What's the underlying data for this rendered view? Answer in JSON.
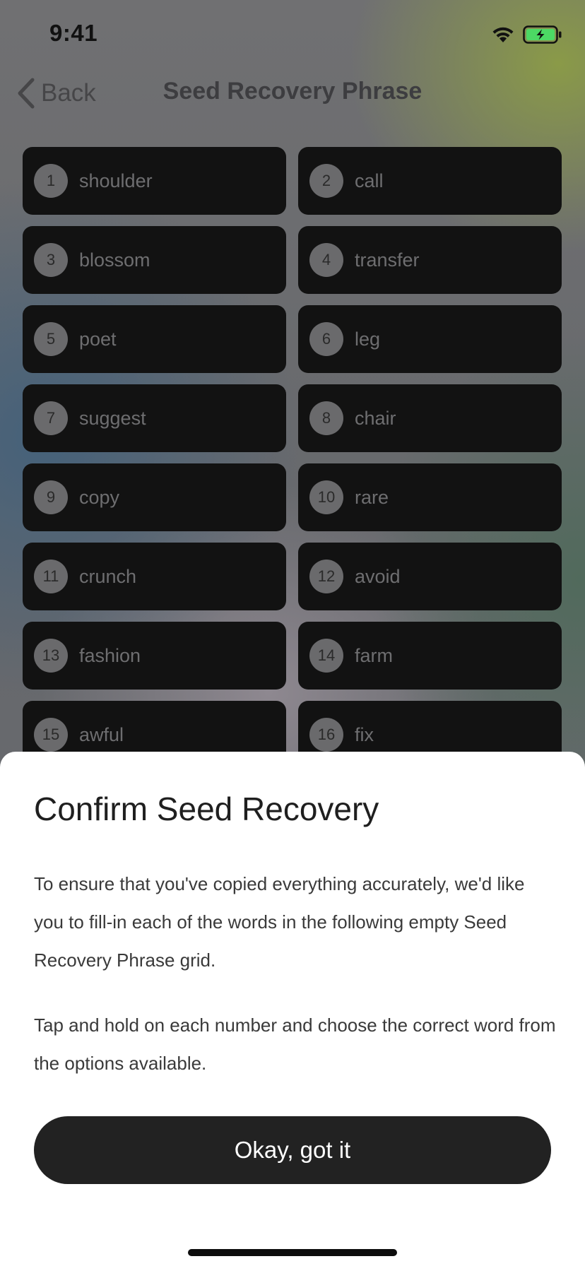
{
  "status_bar": {
    "time": "9:41"
  },
  "nav": {
    "back_label": "Back",
    "title": "Seed Recovery Phrase"
  },
  "seed_words": [
    {
      "num": "1",
      "word": "shoulder"
    },
    {
      "num": "2",
      "word": "call"
    },
    {
      "num": "3",
      "word": "blossom"
    },
    {
      "num": "4",
      "word": "transfer"
    },
    {
      "num": "5",
      "word": "poet"
    },
    {
      "num": "6",
      "word": "leg"
    },
    {
      "num": "7",
      "word": "suggest"
    },
    {
      "num": "8",
      "word": "chair"
    },
    {
      "num": "9",
      "word": "copy"
    },
    {
      "num": "10",
      "word": "rare"
    },
    {
      "num": "11",
      "word": "crunch"
    },
    {
      "num": "12",
      "word": "avoid"
    },
    {
      "num": "13",
      "word": "fashion"
    },
    {
      "num": "14",
      "word": "farm"
    },
    {
      "num": "15",
      "word": "awful"
    },
    {
      "num": "16",
      "word": "fix"
    }
  ],
  "sheet": {
    "title": "Confirm Seed Recovery",
    "paragraph1": "To ensure that you've copied everything accurately, we'd like you to fill-in each of the words in the following empty Seed Recovery Phrase grid.",
    "paragraph2": "Tap and hold on each number and choose the correct word from the options available.",
    "button_label": "Okay, got it"
  },
  "colors": {
    "sheet_background": "#ffffff",
    "button_background": "#222222",
    "word_cell_background": "#121212",
    "battery_fill": "#4cd964"
  },
  "icons": {
    "wifi": "wifi-icon",
    "battery": "battery-charging-icon",
    "back": "chevron-left-icon"
  }
}
